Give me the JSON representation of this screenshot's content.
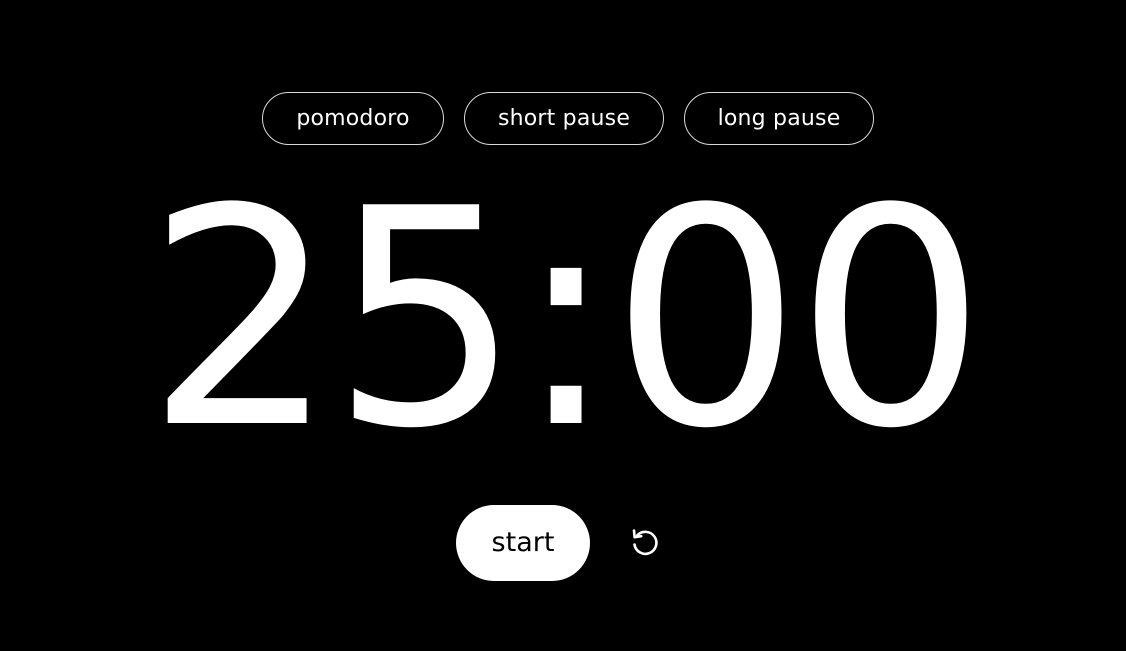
{
  "modes": {
    "pomodoro_label": "pomodoro",
    "short_pause_label": "short pause",
    "long_pause_label": "long pause"
  },
  "timer": {
    "display": "25:00"
  },
  "controls": {
    "start_label": "start",
    "reset_icon": "reset-icon"
  },
  "colors": {
    "background": "#000000",
    "foreground": "#ffffff",
    "tab_border": "#d9d9d9"
  }
}
